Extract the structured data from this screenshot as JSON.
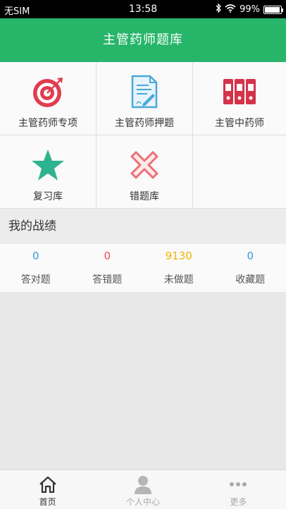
{
  "status_bar": {
    "carrier": "无SIM",
    "time": "13:58",
    "battery": "99%"
  },
  "header": {
    "title": "主管药师题库"
  },
  "menu": [
    {
      "label": "主管药师专项",
      "icon": "target-icon"
    },
    {
      "label": "主管药师押题",
      "icon": "document-pen-icon"
    },
    {
      "label": "主管中药师",
      "icon": "binders-icon"
    },
    {
      "label": "复习库",
      "icon": "star-icon"
    },
    {
      "label": "错题库",
      "icon": "cross-icon"
    }
  ],
  "section": {
    "title": "我的战绩"
  },
  "stats": [
    {
      "value": "0",
      "label": "答对题",
      "color": "#3a9bd9"
    },
    {
      "value": "0",
      "label": "答错题",
      "color": "#e8505b"
    },
    {
      "value": "9130",
      "label": "未做题",
      "color": "#f0b400"
    },
    {
      "value": "0",
      "label": "收藏题",
      "color": "#3a9bd9"
    }
  ],
  "tabs": [
    {
      "label": "首页",
      "icon": "home-icon",
      "active": true
    },
    {
      "label": "个人中心",
      "icon": "user-icon",
      "active": false
    },
    {
      "label": "更多",
      "icon": "more-dots-icon",
      "active": false
    }
  ],
  "colors": {
    "primary": "#27b56a",
    "red": "#e23b4f",
    "teal": "#2fb38f",
    "blue": "#3a9bd9"
  }
}
